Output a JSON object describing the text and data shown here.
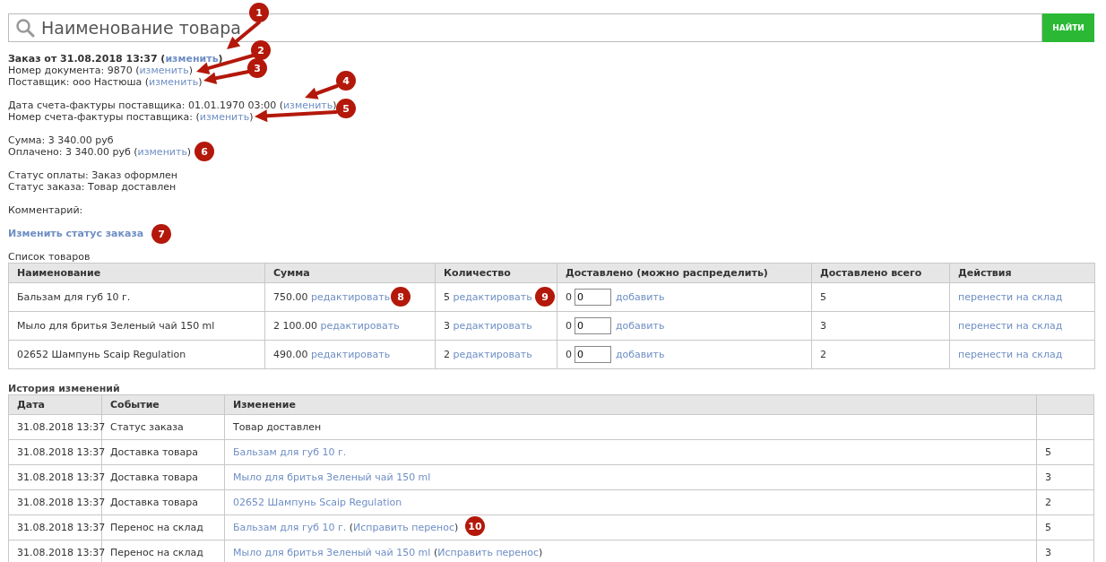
{
  "search": {
    "placeholder": "Наименование товара",
    "button": "НАЙТИ"
  },
  "info_groups": [
    [
      [
        {
          "t": "Заказ от 31.08.2018 13:37 ("
        },
        {
          "t": "изменить",
          "link": true
        },
        {
          "t": ")"
        }
      ],
      [
        {
          "t": "Номер документа: 9870 ("
        },
        {
          "t": "изменить",
          "link": true
        },
        {
          "t": ")"
        }
      ],
      [
        {
          "t": "Поставщик: ооо Настюша ("
        },
        {
          "t": "изменить",
          "link": true
        },
        {
          "t": ")"
        }
      ]
    ],
    [
      [
        {
          "t": "Дата счета-фактуры поставщика: 01.01.1970 03:00 ("
        },
        {
          "t": "изменить",
          "link": true
        },
        {
          "t": ")"
        }
      ],
      [
        {
          "t": "Номер счета-фактуры поставщика: ("
        },
        {
          "t": "изменить",
          "link": true
        },
        {
          "t": ")"
        }
      ]
    ],
    [
      [
        {
          "t": "Сумма: 3 340.00 руб"
        }
      ],
      [
        {
          "t": "Оплачено: 3 340.00 руб ("
        },
        {
          "t": "изменить",
          "link": true
        },
        {
          "t": ")"
        }
      ]
    ],
    [
      [
        {
          "t": "Статус оплаты: Заказ оформлен"
        }
      ],
      [
        {
          "t": "Статус заказа: Товар доставлен"
        }
      ]
    ],
    [
      [
        {
          "t": "Комментарий:"
        }
      ]
    ]
  ],
  "status_link": "Изменить статус заказа",
  "products": {
    "title": "Список товаров",
    "columns": [
      "Наименование",
      "Сумма",
      "Количество",
      "Доставлено (можно распределить)",
      "Доставлено всего",
      "Действия"
    ],
    "rows": [
      {
        "name": "Бальзам для губ 10 г.",
        "sum": "750.00",
        "sum_link": "редактировать",
        "qty": "5",
        "qty_link": "редактировать",
        "available": "0",
        "input": "0",
        "add": "добавить",
        "delivered": "5",
        "action": "перенести на склад"
      },
      {
        "name": "Мыло для бритья Зеленый чай 150 ml",
        "sum": "2 100.00",
        "sum_link": "редактировать",
        "qty": "3",
        "qty_link": "редактировать",
        "available": "0",
        "input": "0",
        "add": "добавить",
        "delivered": "3",
        "action": "перенести на склад"
      },
      {
        "name": "02652 Шампунь Scaip Regulation",
        "sum": "490.00",
        "sum_link": "редактировать",
        "qty": "2",
        "qty_link": "редактировать",
        "available": "0",
        "input": "0",
        "add": "добавить",
        "delivered": "2",
        "action": "перенести на склад"
      }
    ]
  },
  "history": {
    "title": "История изменений",
    "columns": [
      "Дата",
      "Событие",
      "Изменение"
    ],
    "rows": [
      {
        "date": "31.08.2018 13:37",
        "event": "Статус заказа",
        "change": [
          {
            "t": "Товар доставлен"
          }
        ]
      },
      {
        "date": "31.08.2018 13:37",
        "event": "Доставка товара",
        "change": [
          {
            "t": "Бальзам для губ 10 г.",
            "link": true
          }
        ],
        "column_4": "5"
      },
      {
        "date": "31.08.2018 13:37",
        "event": "Доставка товара",
        "change": [
          {
            "t": "Мыло для бритья Зеленый чай 150 ml",
            "link": true
          }
        ],
        "column_4": "3"
      },
      {
        "date": "31.08.2018 13:37",
        "event": "Доставка товара",
        "change": [
          {
            "t": "02652 Шампунь Scaip Regulation",
            "link": true
          }
        ],
        "column_4": "2"
      },
      {
        "date": "31.08.2018 13:37",
        "event": "Перенос на склад",
        "change": [
          {
            "t": "Бальзам для губ 10 г.",
            "link": true
          },
          {
            "t": " ("
          },
          {
            "t": "Исправить перенос",
            "link": true
          },
          {
            "t": ")"
          }
        ],
        "column_4": "5"
      },
      {
        "date": "31.08.2018 13:37",
        "event": "Перенос на склад",
        "change": [
          {
            "t": "Мыло для бритья Зеленый чай 150 ml",
            "link": true
          },
          {
            "t": " ("
          },
          {
            "t": "Исправить перенос",
            "link": true
          },
          {
            "t": ")"
          }
        ],
        "column_4": "3"
      }
    ]
  },
  "callouts": [
    {
      "label": "1"
    },
    {
      "label": "2"
    },
    {
      "label": "3"
    },
    {
      "label": "4"
    },
    {
      "label": "5"
    },
    {
      "label": "6"
    },
    {
      "label": "7"
    },
    {
      "label": "8"
    },
    {
      "label": "9"
    },
    {
      "label": "10"
    }
  ]
}
